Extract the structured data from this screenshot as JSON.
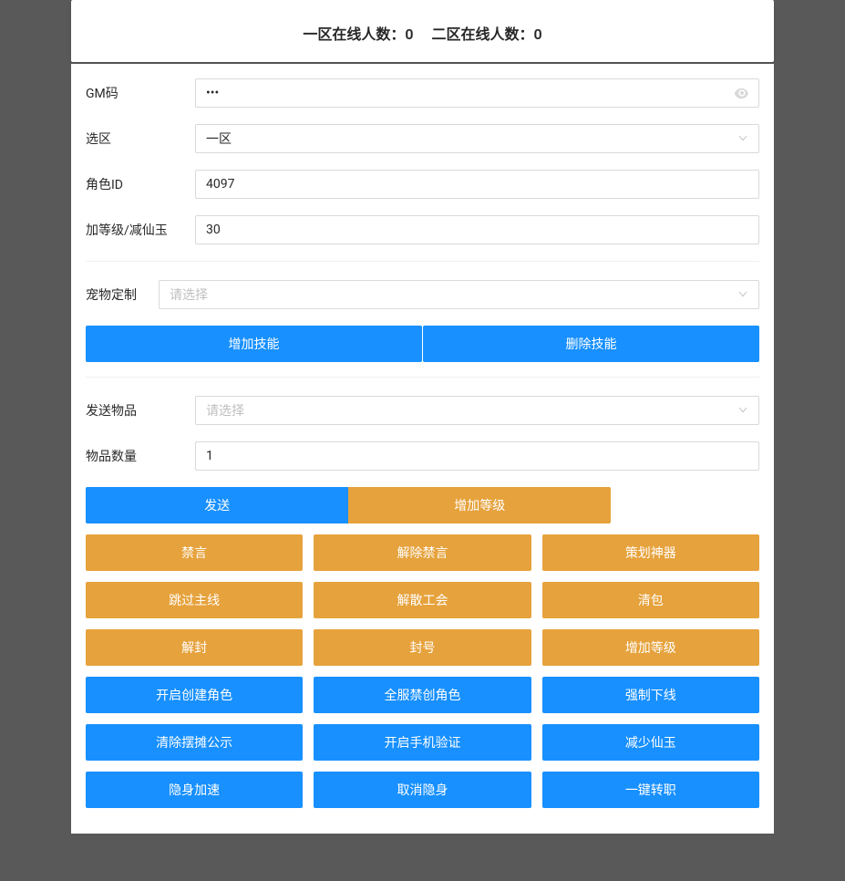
{
  "header": {
    "zone1_label": "一区在线人数：",
    "zone1_count": "0",
    "zone2_label": "二区在线人数：",
    "zone2_count": "0"
  },
  "form1": {
    "gm_code_label": "GM码",
    "gm_code_value": "•••",
    "zone_label": "选区",
    "zone_value": "一区",
    "role_id_label": "角色ID",
    "role_id_value": "4097",
    "level_label": "加等级/减仙玉",
    "level_value": "30"
  },
  "pet_section": {
    "label": "宠物定制",
    "placeholder": "请选择",
    "add_skill": "增加技能",
    "remove_skill": "删除技能"
  },
  "item_section": {
    "send_item_label": "发送物品",
    "send_item_placeholder": "请选择",
    "item_count_label": "物品数量",
    "item_count_value": "1"
  },
  "buttons": {
    "send": "发送",
    "add_level": "增加等级",
    "mute": "禁言",
    "unmute": "解除禁言",
    "planner_artifact": "策划神器",
    "skip_main": "跳过主线",
    "dissolve_guild": "解散工会",
    "clear_bag": "清包",
    "unban": "解封",
    "ban": "封号",
    "add_level2": "增加等级",
    "enable_create_role": "开启创建角色",
    "global_ban_create_role": "全服禁创角色",
    "force_offline": "强制下线",
    "clear_stall_notice": "清除摆摊公示",
    "enable_phone_verify": "开启手机验证",
    "reduce_jade": "减少仙玉",
    "stealth_speed": "隐身加速",
    "cancel_stealth": "取消隐身",
    "one_key_change_job": "一键转职"
  },
  "select_placeholder": "请选择"
}
